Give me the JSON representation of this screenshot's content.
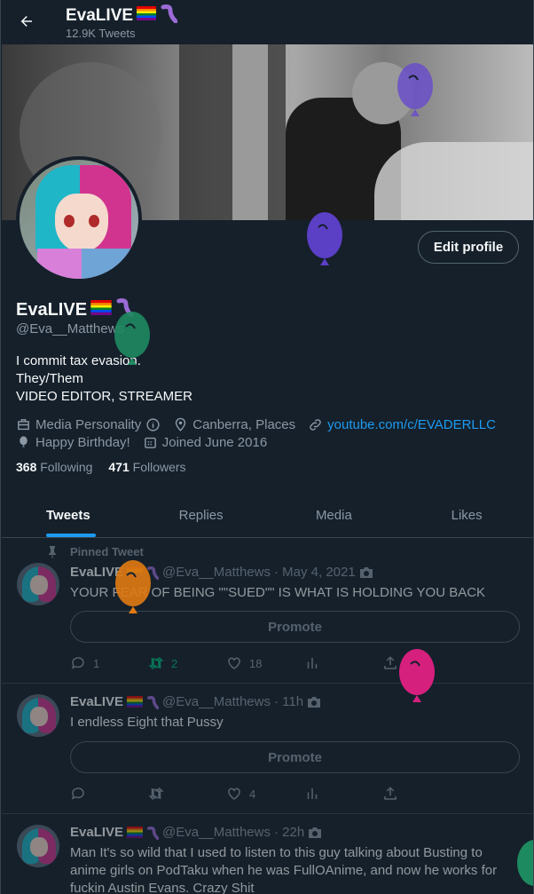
{
  "header": {
    "title": "EvaLIVE",
    "tweet_count": "12.9K Tweets"
  },
  "profile": {
    "edit_label": "Edit profile",
    "name": "EvaLIVE",
    "handle": "@Eva__Matthews",
    "bio_lines": [
      "I commit tax evasion.",
      "They/Them",
      "VIDEO EDITOR, STREAMER"
    ],
    "category": "Media Personality",
    "location": "Canberra, Places",
    "website": "youtube.com/c/EVADERLLC",
    "birthday": "Happy Birthday!",
    "joined": "Joined June 2016",
    "following_count": "368",
    "following_label": "Following",
    "followers_count": "471",
    "followers_label": "Followers"
  },
  "tabs": [
    {
      "label": "Tweets",
      "active": true
    },
    {
      "label": "Replies",
      "active": false
    },
    {
      "label": "Media",
      "active": false
    },
    {
      "label": "Likes",
      "active": false
    }
  ],
  "tweets": [
    {
      "pinned_label": "Pinned Tweet",
      "name": "EvaLIVE",
      "handle": "@Eva__Matthews",
      "time": "· May 4, 2021",
      "text": "YOUR FEAR OF BEING \"\"SUED\"\" IS WHAT IS HOLDING YOU BACK",
      "promote": "Promote",
      "replies": "1",
      "retweets": "2",
      "likes": "18"
    },
    {
      "name": "EvaLIVE",
      "handle": "@Eva__Matthews",
      "time": "· 11h",
      "text": "I endless Eight that Pussy",
      "promote": "Promote",
      "replies": "",
      "retweets": "",
      "likes": "4"
    },
    {
      "name": "EvaLIVE",
      "handle": "@Eva__Matthews",
      "time": "· 22h",
      "text": "Man It's so wild that I used to listen to this guy talking about Busting to anime girls on PodTaku when he was FullOAnime, and now he works for fuckin Austin Evans. Crazy Shit"
    }
  ],
  "colors": {
    "background": "#15202b",
    "accent": "#1d9bf0",
    "balloons": [
      "#6a4fc9",
      "#1e8a60",
      "#e07a12",
      "#d6207e"
    ]
  }
}
